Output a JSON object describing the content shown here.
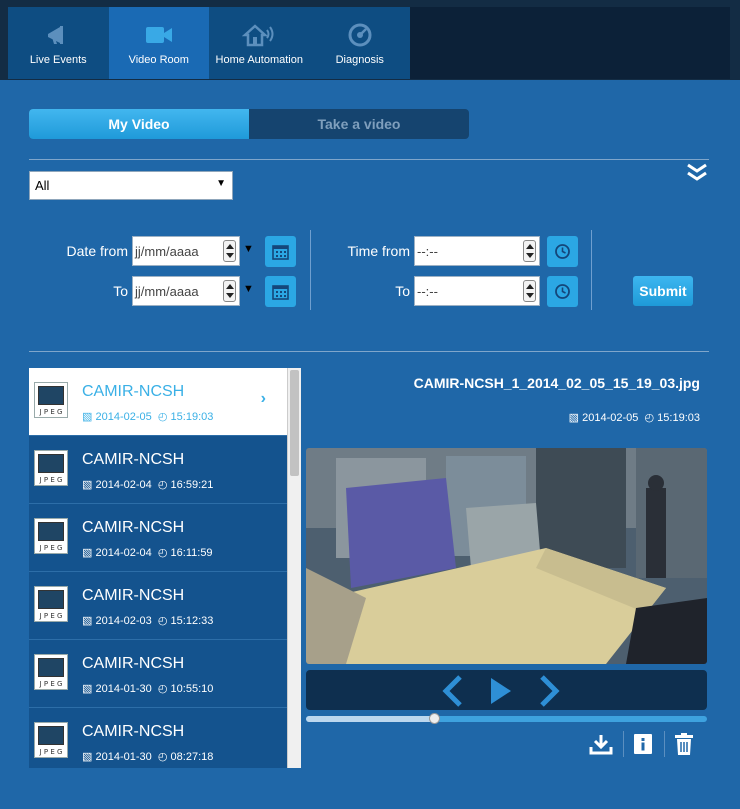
{
  "nav": {
    "tabs": [
      {
        "label": "Live Events",
        "icon": "megaphone-icon"
      },
      {
        "label": "Video Room",
        "icon": "video-camera-icon",
        "active": true
      },
      {
        "label": "Home Automation",
        "icon": "house-signal-icon"
      },
      {
        "label": "Diagnosis",
        "icon": "diagnosis-gauge-icon"
      }
    ]
  },
  "segment": {
    "my_video": "My Video",
    "take_video": "Take a video"
  },
  "filter": {
    "selected": "All"
  },
  "dates": {
    "date_from_label": "Date from",
    "to_label": "To",
    "date_placeholder": "jj/mm/aaaa",
    "time_from_label": "Time from",
    "time_placeholder": "--:--"
  },
  "submit_label": "Submit",
  "list": {
    "items": [
      {
        "name": "CAMIR-NCSH",
        "date": "2014-02-05",
        "time": "15:19:03",
        "selected": true
      },
      {
        "name": "CAMIR-NCSH",
        "date": "2014-02-04",
        "time": "16:59:21"
      },
      {
        "name": "CAMIR-NCSH",
        "date": "2014-02-04",
        "time": "16:11:59"
      },
      {
        "name": "CAMIR-NCSH",
        "date": "2014-02-03",
        "time": "15:12:33"
      },
      {
        "name": "CAMIR-NCSH",
        "date": "2014-01-30",
        "time": "10:55:10"
      },
      {
        "name": "CAMIR-NCSH",
        "date": "2014-01-30",
        "time": "08:27:18"
      }
    ],
    "thumb_caption": "J P E G"
  },
  "detail": {
    "file_name": "CAMIR-NCSH_1_2014_02_05_15_19_03.jpg",
    "date": "2014-02-05",
    "time": "15:19:03",
    "progress": 0.32
  },
  "colors": {
    "accent": "#2ba7e4",
    "background": "#1f67a8",
    "nav_bg": "#0e4d82"
  }
}
